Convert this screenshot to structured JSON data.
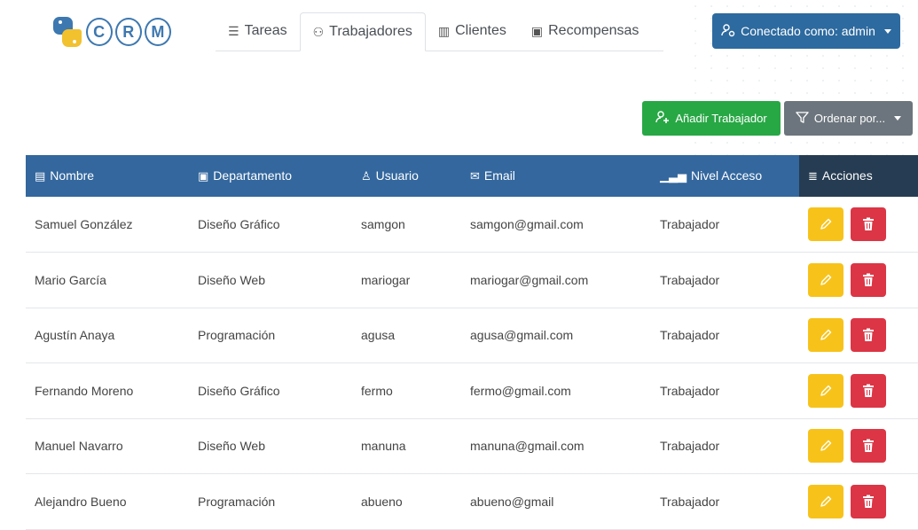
{
  "logo": {
    "text_c": "C",
    "text_r": "R",
    "text_m": "M"
  },
  "tabs": [
    {
      "label": "Tareas",
      "icon": "list-icon",
      "glyph": "☰"
    },
    {
      "label": "Trabajadores",
      "icon": "users-icon",
      "glyph": "⚇"
    },
    {
      "label": "Clientes",
      "icon": "buildings-icon",
      "glyph": "▥"
    },
    {
      "label": "Recompensas",
      "icon": "money-icon",
      "glyph": "▣"
    }
  ],
  "user_menu": {
    "label": "Conectado como: admin"
  },
  "actions": {
    "add_label": "Añadir Trabajador",
    "sort_label": "Ordenar por..."
  },
  "table": {
    "headers": [
      "Nombre",
      "Departamento",
      "Usuario",
      "Email",
      "Nivel Acceso",
      "Acciones"
    ],
    "rows": [
      [
        "Samuel González",
        "Diseño Gráfico",
        "samgon",
        "samgon@gmail.com",
        "Trabajador"
      ],
      [
        "Mario García",
        "Diseño Web",
        "mariogar",
        "mariogar@gmail.com",
        "Trabajador"
      ],
      [
        "Agustín Anaya",
        "Programación",
        "agusa",
        "agusa@gmail.com",
        "Trabajador"
      ],
      [
        "Fernando Moreno",
        "Diseño Gráfico",
        "fermo",
        "fermo@gmail.com",
        "Trabajador"
      ],
      [
        "Manuel Navarro",
        "Diseño Web",
        "manuna",
        "manuna@gmail.com",
        "Trabajador"
      ],
      [
        "Alejandro Bueno",
        "Programación",
        "abueno",
        "abueno@gmail",
        "Trabajador"
      ]
    ]
  },
  "colors": {
    "header_bg": "#33679e",
    "actions_header_bg": "#263c52",
    "primary": "#2d6a9f",
    "success": "#28a745",
    "secondary": "#6c757d",
    "warning": "#f7c31a",
    "danger": "#dc3545"
  }
}
